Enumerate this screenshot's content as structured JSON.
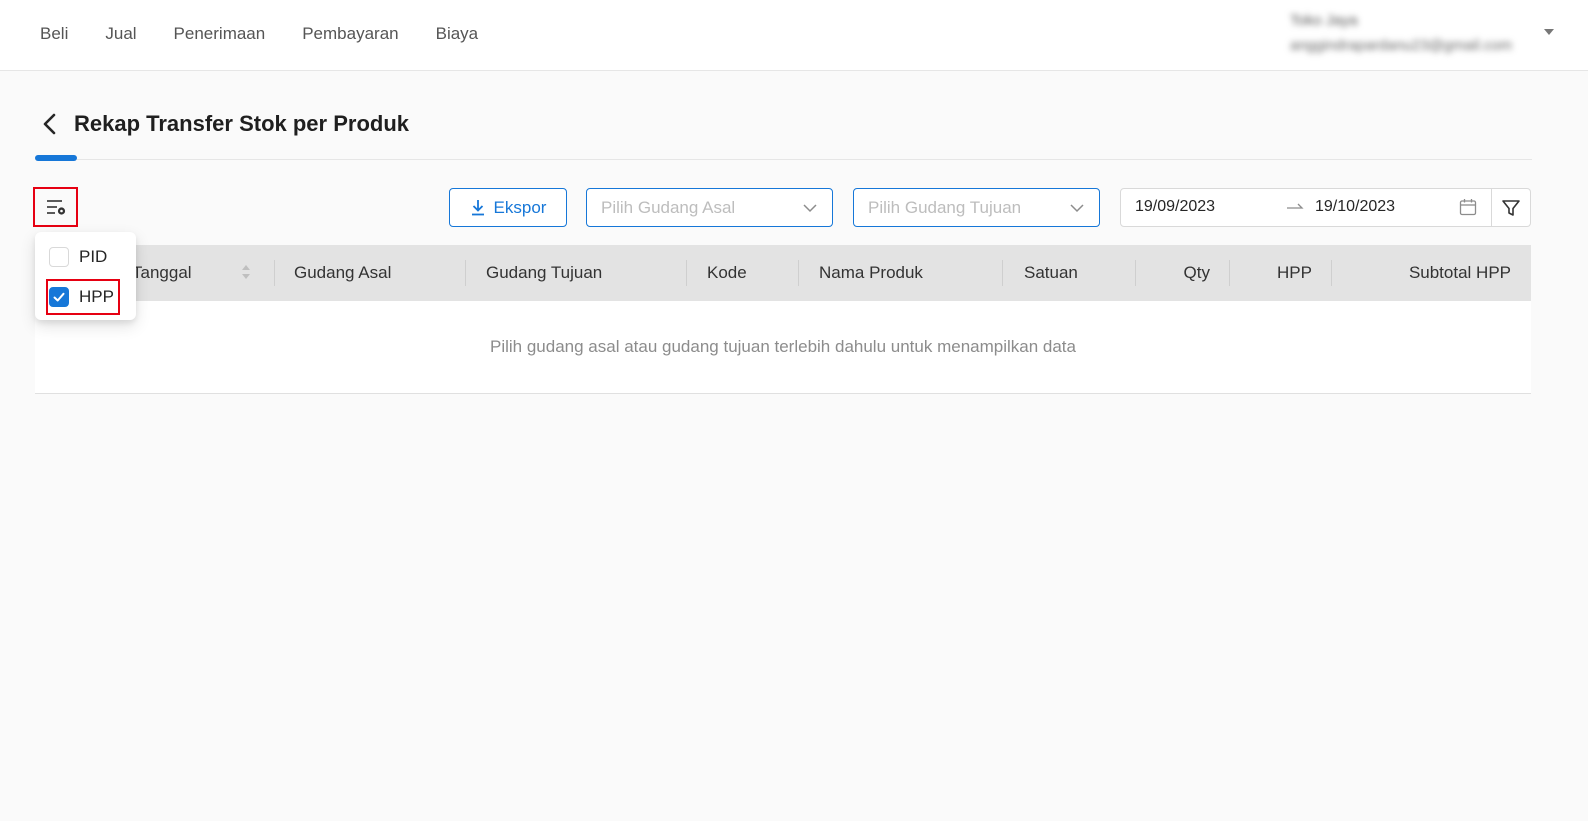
{
  "nav": {
    "items": [
      "Beli",
      "Jual",
      "Penerimaan",
      "Pembayaran",
      "Biaya"
    ]
  },
  "user": {
    "name": "Toko Jaya",
    "email": "anggindrapardanu23@gmail.com"
  },
  "page": {
    "title": "Rekap Transfer Stok per Produk"
  },
  "toolbar": {
    "export_label": "Ekspor",
    "source_placeholder": "Pilih Gudang Asal",
    "dest_placeholder": "Pilih Gudang Tujuan",
    "date_start": "19/09/2023",
    "date_end": "19/10/2023"
  },
  "column_menu": {
    "items": [
      {
        "label": "PID",
        "checked": false
      },
      {
        "label": "HPP",
        "checked": true
      }
    ]
  },
  "table": {
    "columns": [
      "Tanggal",
      "Gudang Asal",
      "Gudang Tujuan",
      "Kode",
      "Nama Produk",
      "Satuan",
      "Qty",
      "HPP",
      "Subtotal HPP"
    ],
    "empty_text": "Pilih gudang asal atau gudang tujuan terlebih dahulu untuk menampilkan data"
  },
  "colors": {
    "accent": "#1677d8",
    "highlight": "#e60012",
    "header_bg": "#e3e3e3"
  }
}
